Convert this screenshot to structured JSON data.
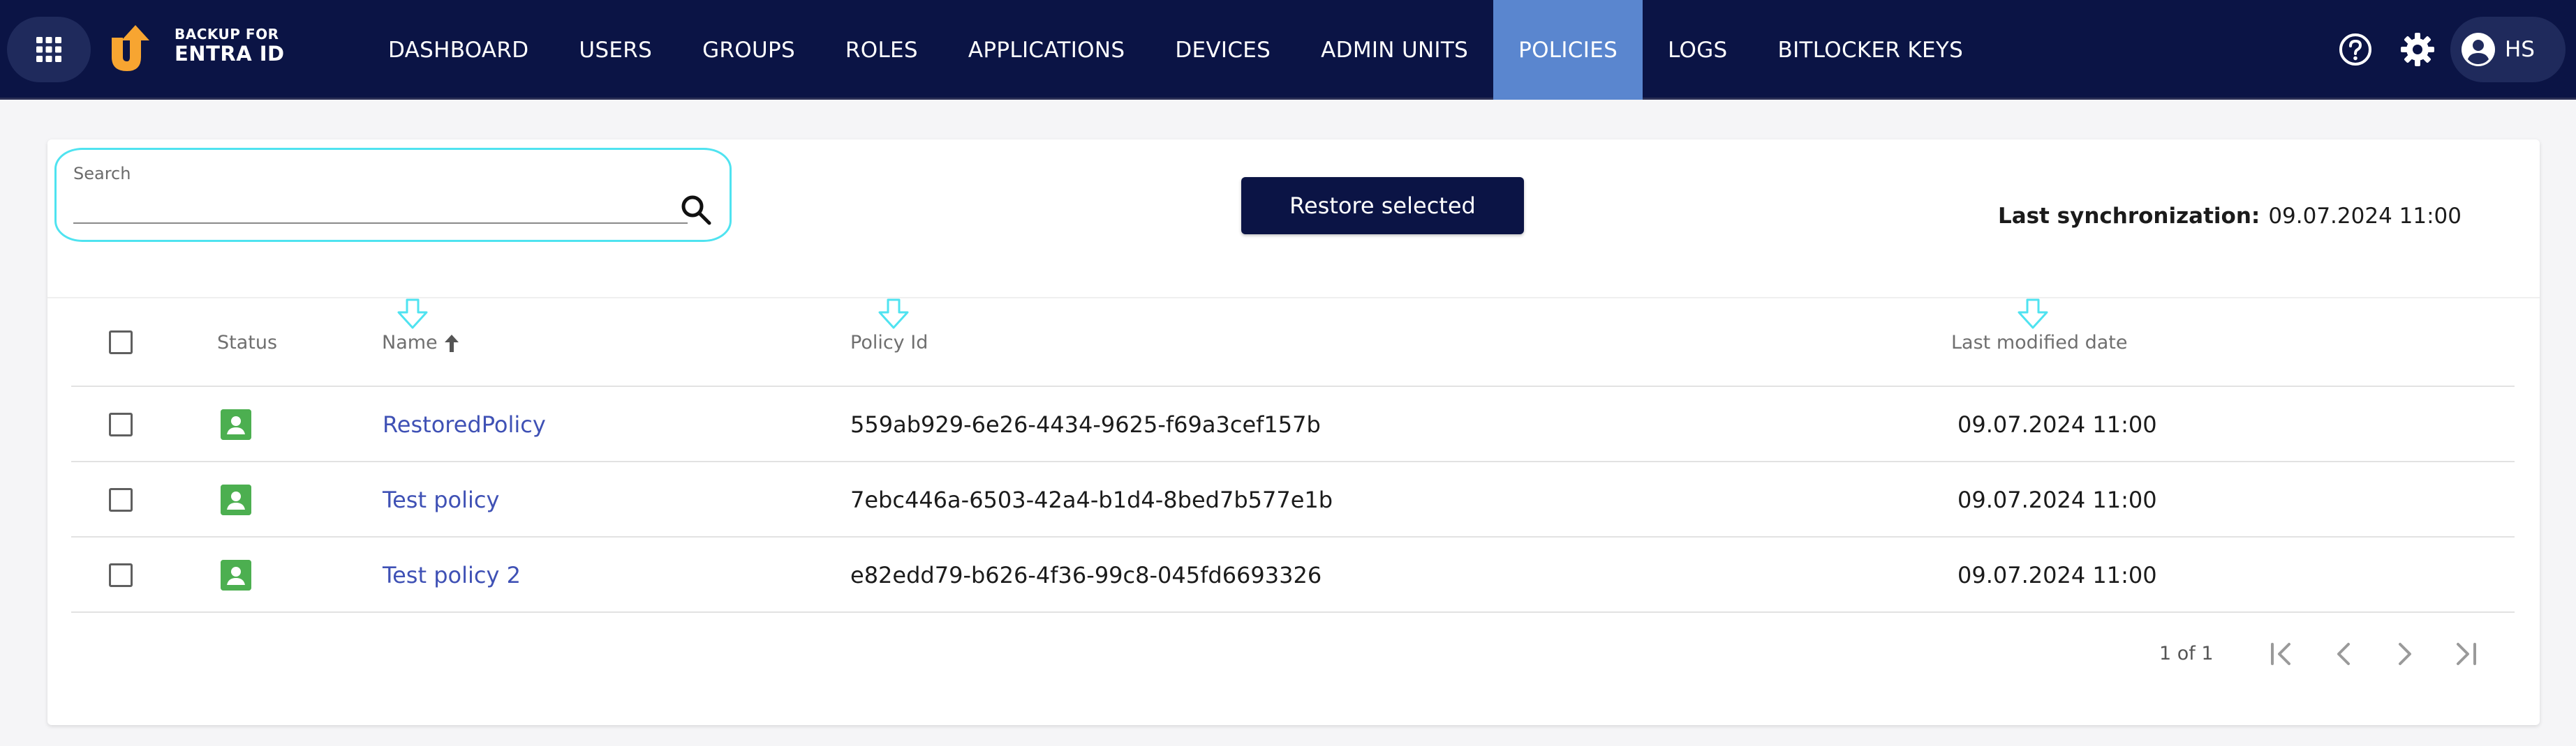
{
  "brand": {
    "line1": "BACKUP FOR",
    "line2": "ENTRA ID"
  },
  "nav": {
    "items": [
      {
        "label": "DASHBOARD"
      },
      {
        "label": "USERS"
      },
      {
        "label": "GROUPS"
      },
      {
        "label": "ROLES"
      },
      {
        "label": "APPLICATIONS"
      },
      {
        "label": "DEVICES"
      },
      {
        "label": "ADMIN UNITS"
      },
      {
        "label": "POLICIES",
        "active": true
      },
      {
        "label": "LOGS"
      },
      {
        "label": "BITLOCKER KEYS"
      }
    ]
  },
  "user": {
    "initials": "HS"
  },
  "toolbar": {
    "search_label": "Search",
    "search_value": "",
    "restore_label": "Restore selected",
    "sync_label": "Last synchronization:",
    "sync_value": "09.07.2024 11:00"
  },
  "table": {
    "columns": {
      "status": "Status",
      "name": "Name",
      "policy_id": "Policy Id",
      "last_modified": "Last modified date"
    },
    "sort": {
      "column": "name",
      "direction": "ascending"
    },
    "rows": [
      {
        "name": "RestoredPolicy",
        "policy_id": "559ab929-6e26-4434-9625-f69a3cef157b",
        "last_modified": "09.07.2024 11:00"
      },
      {
        "name": "Test policy",
        "policy_id": "7ebc446a-6503-42a4-b1d4-8bed7b577e1b",
        "last_modified": "09.07.2024 11:00"
      },
      {
        "name": "Test policy 2",
        "policy_id": "e82edd79-b626-4f36-99c8-045fd6693326",
        "last_modified": "09.07.2024 11:00"
      }
    ]
  },
  "pagination": {
    "info": "1 of 1"
  },
  "colors": {
    "nav_bg": "#0b1445",
    "nav_active": "#5a86cf",
    "accent_link": "#3f51b5",
    "status_green": "#4caf50",
    "logo_orange": "#f7a531",
    "highlight_cyan": "#4fe3f0"
  },
  "icons": {
    "apps": "apps-grid-icon",
    "logo": "backup-logo-icon",
    "help": "help-circle-icon",
    "settings": "gear-icon",
    "account": "account-circle-icon",
    "search": "search-icon",
    "sort": "sort-arrow-up-icon",
    "status": "status-person-icon",
    "hint": "hint-arrow-down-icon",
    "first_page": "first-page-icon",
    "prev_page": "chevron-left-icon",
    "next_page": "chevron-right-icon",
    "last_page": "last-page-icon"
  }
}
